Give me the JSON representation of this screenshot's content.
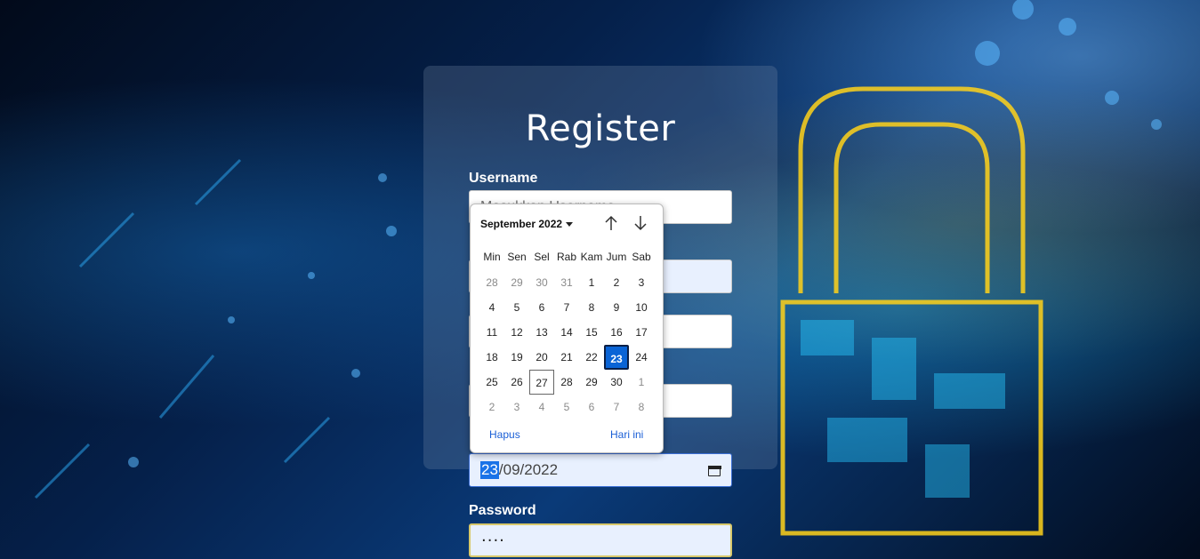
{
  "page": {
    "title": "Register"
  },
  "form": {
    "username_label": "Username",
    "username_placeholder": "Masukkan Username",
    "date_value_day": "23",
    "date_value_rest": "/09/2022",
    "password_label": "Password",
    "password_value": "····"
  },
  "calendar": {
    "month_label": "September 2022",
    "weekdays": [
      "Min",
      "Sen",
      "Sel",
      "Rab",
      "Kam",
      "Jum",
      "Sab"
    ],
    "weeks": [
      [
        {
          "d": "28",
          "o": true
        },
        {
          "d": "29",
          "o": true
        },
        {
          "d": "30",
          "o": true
        },
        {
          "d": "31",
          "o": true
        },
        {
          "d": "1"
        },
        {
          "d": "2"
        },
        {
          "d": "3"
        }
      ],
      [
        {
          "d": "4"
        },
        {
          "d": "5"
        },
        {
          "d": "6"
        },
        {
          "d": "7"
        },
        {
          "d": "8"
        },
        {
          "d": "9"
        },
        {
          "d": "10"
        }
      ],
      [
        {
          "d": "11"
        },
        {
          "d": "12"
        },
        {
          "d": "13"
        },
        {
          "d": "14"
        },
        {
          "d": "15"
        },
        {
          "d": "16"
        },
        {
          "d": "17"
        }
      ],
      [
        {
          "d": "18"
        },
        {
          "d": "19"
        },
        {
          "d": "20"
        },
        {
          "d": "21"
        },
        {
          "d": "22"
        },
        {
          "d": "23",
          "s": true
        },
        {
          "d": "24"
        }
      ],
      [
        {
          "d": "25"
        },
        {
          "d": "26"
        },
        {
          "d": "27",
          "t": true
        },
        {
          "d": "28"
        },
        {
          "d": "29"
        },
        {
          "d": "30"
        },
        {
          "d": "1",
          "o": true
        }
      ],
      [
        {
          "d": "2",
          "o": true
        },
        {
          "d": "3",
          "o": true
        },
        {
          "d": "4",
          "o": true
        },
        {
          "d": "5",
          "o": true
        },
        {
          "d": "6",
          "o": true
        },
        {
          "d": "7",
          "o": true
        },
        {
          "d": "8",
          "o": true
        }
      ]
    ],
    "clear_label": "Hapus",
    "today_label": "Hari ini",
    "prev_icon": "arrow-up-icon",
    "next_icon": "arrow-down-icon"
  },
  "colors": {
    "selected_day": "#0a64d6",
    "link": "#1a5fd6",
    "autofill_bg": "#e8f0fe"
  }
}
